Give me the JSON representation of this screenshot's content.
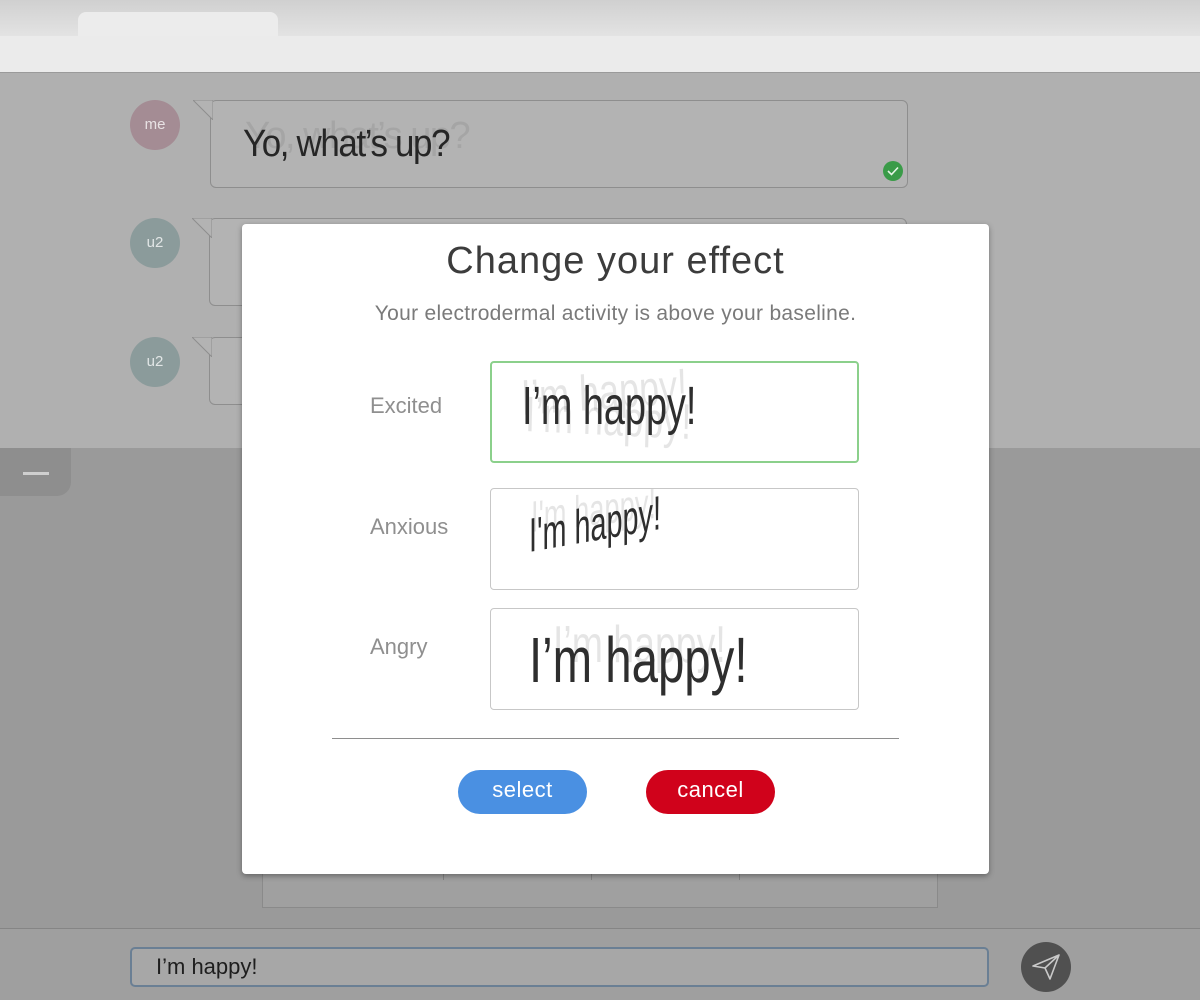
{
  "chat": {
    "messages": [
      {
        "sender": "me",
        "text": "Yo, what’s up?",
        "status": "sent",
        "status_icon": "check-circle-icon"
      },
      {
        "sender": "u2",
        "text": ""
      },
      {
        "sender": "u2",
        "text": ""
      }
    ],
    "avatar_colors": {
      "me": "#a48c94",
      "u2": "#8b9b9b"
    }
  },
  "modal": {
    "title": "Change your effect",
    "subtitle": "Your electrodermal activity is above your baseline.",
    "options": [
      {
        "label": "Excited",
        "preview_text": "I’m happy!",
        "selected": true
      },
      {
        "label": "Anxious",
        "preview_text": "I'm happy!",
        "selected": false
      },
      {
        "label": "Angry",
        "preview_text": "I’m happy!",
        "selected": false
      }
    ],
    "select_label": "select",
    "cancel_label": "cancel",
    "colors": {
      "select": "#4a90e2",
      "cancel": "#d0021b",
      "selected_border": "#8bd08b"
    }
  },
  "composer": {
    "input_value": "I’m happy!",
    "send_icon": "paper-plane-icon"
  }
}
